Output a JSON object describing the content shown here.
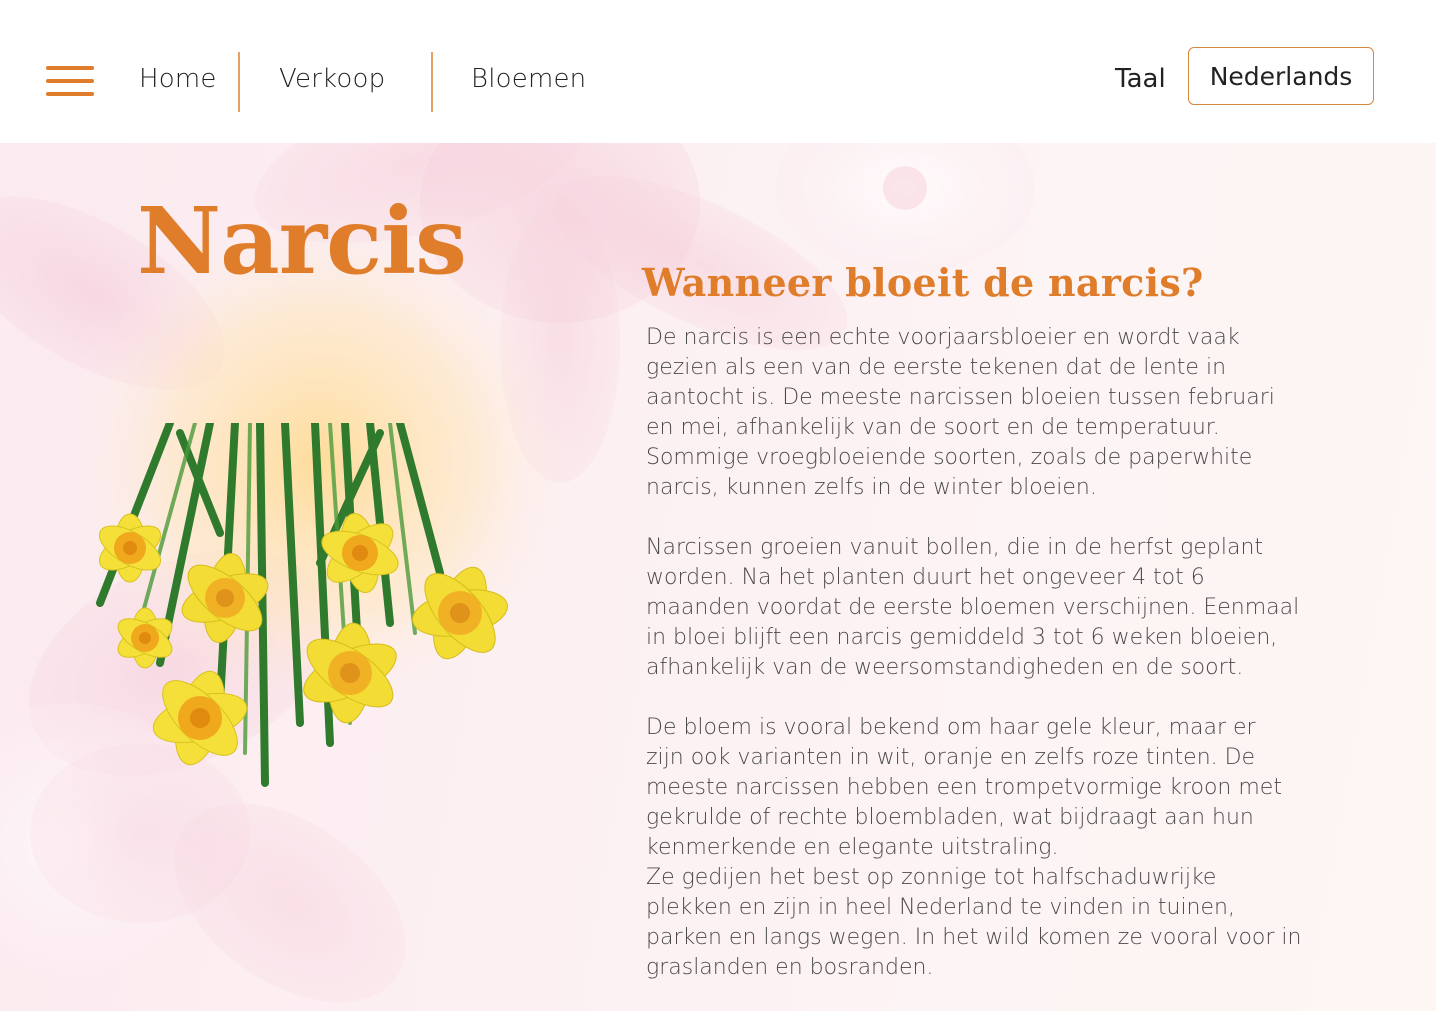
{
  "header": {
    "nav": [
      {
        "label": "Home"
      },
      {
        "label": "Verkoop"
      },
      {
        "label": "Bloemen"
      }
    ],
    "language_label": "Taal",
    "language_value": "Nederlands"
  },
  "main": {
    "title": "Narcis",
    "subtitle": "Wanneer bloeit de narcis?",
    "paragraphs": [
      "De narcis is een echte voorjaarsbloeier en wordt vaak\ngezien als een van de eerste tekenen dat de lente in\naantocht is. De meeste narcissen bloeien tussen februari\nen mei, afhankelijk van de soort en de temperatuur.\nSommige vroegbloeiende soorten, zoals de paperwhite\nnarcis, kunnen zelfs in de winter bloeien.",
      "Narcissen groeien vanuit bollen, die in de herfst geplant\nworden. Na het planten duurt het ongeveer 4 tot 6\nmaanden voordat de eerste bloemen verschijnen. Eenmaal\nin bloei blijft een narcis gemiddeld 3 tot 6 weken bloeien,\nafhankelijk van de weersomstandigheden en de soort.",
      "De bloem is vooral bekend om haar gele kleur, maar er\nzijn ook varianten in wit, oranje en zelfs roze tinten. De\nmeeste narcissen hebben een trompetvormige kroon met\ngekrulde of rechte bloembladen, wat bijdraagt aan hun\nkenmerkende en elegante uitstraling.",
      "Ze gedijen het best op zonnige tot halfschaduwrijke\nplekken en zijn in heel Nederland te vinden in tuinen,\nparken en langs wegen. In het wild komen ze vooral voor in\ngraslanden en bosranden."
    ]
  },
  "icons": {
    "menu": "hamburger-menu-icon"
  },
  "colors": {
    "accent": "#e07d2b",
    "divider": "#e5a25e",
    "text": "#4a4a4a",
    "background": "#fcf0f2"
  }
}
